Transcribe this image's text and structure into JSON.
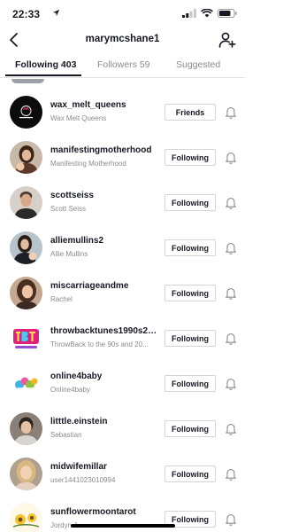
{
  "status_bar": {
    "time": "22:33"
  },
  "header": {
    "title": "marymcshane1"
  },
  "tabs": [
    {
      "label": "Following 403",
      "active": true
    },
    {
      "label": "Followers 59",
      "active": false
    },
    {
      "label": "Suggested",
      "active": false
    }
  ],
  "users": [
    {
      "username": "wax_melt_queens",
      "display_name": "Wax Melt Queens",
      "button": "Friends",
      "avatar_icon": "wax-melt-queens-logo",
      "avatar_color": "#111111"
    },
    {
      "username": "manifestingmotherhood",
      "display_name": "Manifesting Motherhood",
      "button": "Following",
      "avatar_icon": "person-photo",
      "avatar_color": "#7a5a48"
    },
    {
      "username": "scottseiss",
      "display_name": "Scott Seiss",
      "button": "Following",
      "avatar_icon": "person-photo",
      "avatar_color": "#9c8a7c"
    },
    {
      "username": "alliemullins2",
      "display_name": "Allie Mullins",
      "button": "Following",
      "avatar_icon": "person-photo",
      "avatar_color": "#3b3b4a"
    },
    {
      "username": "miscarriageandme",
      "display_name": "Rachel",
      "button": "Following",
      "avatar_icon": "person-photo",
      "avatar_color": "#6b4a3a"
    },
    {
      "username": "throwbacktunes1990s20...",
      "display_name": "ThrowBack to the 90s and 20...",
      "button": "Following",
      "avatar_icon": "tbt-logo",
      "avatar_color": "#e0207a"
    },
    {
      "username": "online4baby",
      "display_name": "Online4baby",
      "button": "Following",
      "avatar_icon": "online4baby-logo",
      "avatar_color": "#3db5e6"
    },
    {
      "username": "litttle.einstein",
      "display_name": "Sebastian",
      "button": "Following",
      "avatar_icon": "person-photo",
      "avatar_color": "#5a5048"
    },
    {
      "username": "midwifemillar",
      "display_name": "user1441023010994",
      "button": "Following",
      "avatar_icon": "person-photo",
      "avatar_color": "#c9a98a"
    },
    {
      "username": "sunflowermoontarot",
      "display_name": "Jordyn J... ...",
      "button": "Following",
      "avatar_icon": "sunflower-logo",
      "avatar_color": "#e8b42a"
    }
  ]
}
